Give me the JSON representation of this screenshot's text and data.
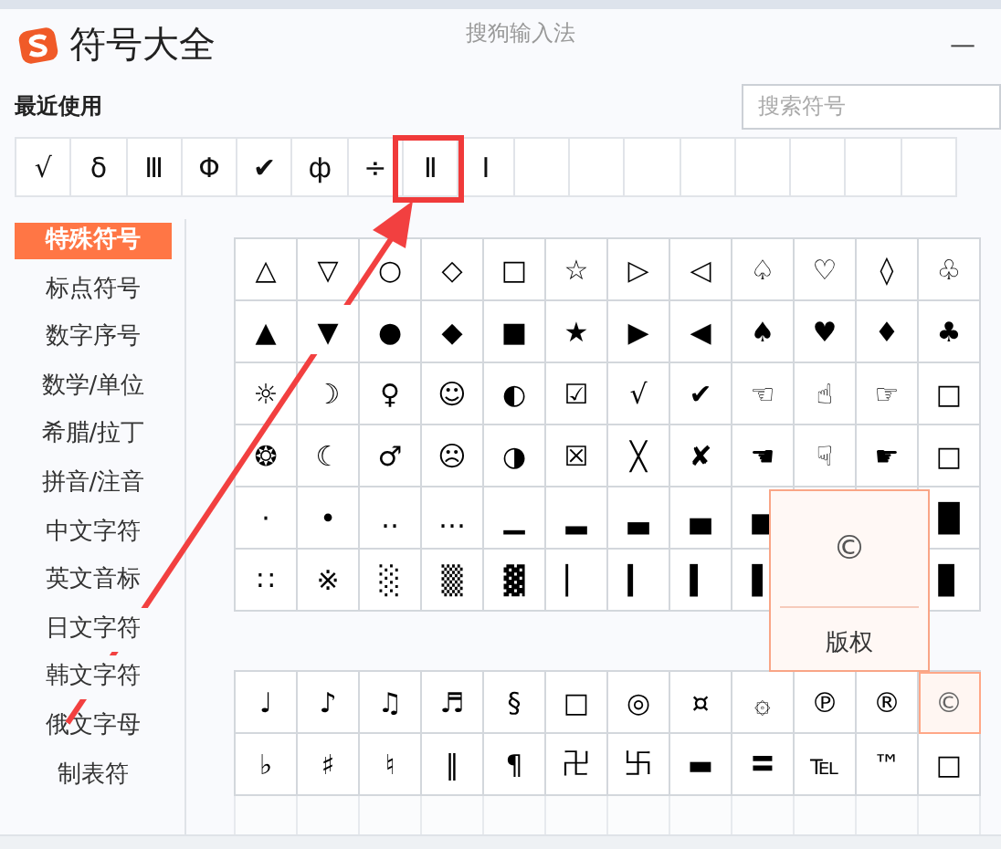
{
  "window": {
    "title": "符号大全",
    "app_name": "搜狗输入法",
    "minimize": "—"
  },
  "recent": {
    "label": "最近使用",
    "symbols": [
      "√",
      "δ",
      "Ⅲ",
      "Φ",
      "✔",
      "ф",
      "÷",
      "Ⅱ",
      "Ⅰ"
    ]
  },
  "search": {
    "placeholder": "搜索符号"
  },
  "sidebar": {
    "items": [
      {
        "label": "特殊符号",
        "selected": true
      },
      {
        "label": "标点符号",
        "selected": false
      },
      {
        "label": "数字序号",
        "selected": false
      },
      {
        "label": "数学/单位",
        "selected": false
      },
      {
        "label": "希腊/拉丁",
        "selected": false
      },
      {
        "label": "拼音/注音",
        "selected": false
      },
      {
        "label": "中文字符",
        "selected": false
      },
      {
        "label": "英文音标",
        "selected": false
      },
      {
        "label": "日文字符",
        "selected": false
      },
      {
        "label": "韩文字符",
        "selected": false
      },
      {
        "label": "俄文字母",
        "selected": false
      },
      {
        "label": "制表符",
        "selected": false
      }
    ]
  },
  "sections": [
    {
      "rows": [
        [
          {
            "symbol": "△",
            "hovered": false
          },
          {
            "symbol": "▽",
            "hovered": false
          },
          {
            "symbol": "○",
            "hovered": false
          },
          {
            "symbol": "◇",
            "hovered": false
          },
          {
            "symbol": "□",
            "hovered": false
          },
          {
            "symbol": "☆",
            "hovered": false
          },
          {
            "symbol": "▷",
            "hovered": false
          },
          {
            "symbol": "◁",
            "hovered": false
          },
          {
            "symbol": "♤",
            "hovered": false
          },
          {
            "symbol": "♡",
            "hovered": false
          },
          {
            "symbol": "◊",
            "hovered": false
          },
          {
            "symbol": "♧",
            "hovered": false
          }
        ],
        [
          {
            "symbol": "▲",
            "hovered": false
          },
          {
            "symbol": "▼",
            "hovered": false
          },
          {
            "symbol": "●",
            "hovered": false
          },
          {
            "symbol": "◆",
            "hovered": false
          },
          {
            "symbol": "■",
            "hovered": false
          },
          {
            "symbol": "★",
            "hovered": false
          },
          {
            "symbol": "▶",
            "hovered": false
          },
          {
            "symbol": "◀",
            "hovered": false
          },
          {
            "symbol": "♠",
            "hovered": false
          },
          {
            "symbol": "♥",
            "hovered": false
          },
          {
            "symbol": "♦",
            "hovered": false
          },
          {
            "symbol": "♣",
            "hovered": false
          }
        ],
        [
          {
            "symbol": "☼",
            "hovered": false
          },
          {
            "symbol": "☽",
            "hovered": false
          },
          {
            "symbol": "♀",
            "hovered": false
          },
          {
            "symbol": "☺",
            "hovered": false
          },
          {
            "symbol": "◐",
            "hovered": false
          },
          {
            "symbol": "☑",
            "hovered": false
          },
          {
            "symbol": "√",
            "hovered": false
          },
          {
            "symbol": "✔",
            "hovered": false
          },
          {
            "symbol": "☜",
            "hovered": false
          },
          {
            "symbol": "☝",
            "hovered": false
          },
          {
            "symbol": "☞",
            "hovered": false
          },
          {
            "symbol": "□",
            "hovered": false
          }
        ],
        [
          {
            "symbol": "❂",
            "hovered": false
          },
          {
            "symbol": "☾",
            "hovered": false
          },
          {
            "symbol": "♂",
            "hovered": false
          },
          {
            "symbol": "☹",
            "hovered": false
          },
          {
            "symbol": "◑",
            "hovered": false
          },
          {
            "symbol": "☒",
            "hovered": false
          },
          {
            "symbol": "╳",
            "hovered": false
          },
          {
            "symbol": "✘",
            "hovered": false
          },
          {
            "symbol": "☚",
            "hovered": false
          },
          {
            "symbol": "☟",
            "hovered": false
          },
          {
            "symbol": "☛",
            "hovered": false
          },
          {
            "symbol": "□",
            "hovered": false
          }
        ],
        [
          {
            "symbol": "·",
            "hovered": false
          },
          {
            "symbol": "•",
            "hovered": false
          },
          {
            "symbol": "‥",
            "hovered": false
          },
          {
            "symbol": "…",
            "hovered": false
          },
          {
            "symbol": "▁",
            "hovered": false
          },
          {
            "symbol": "▂",
            "hovered": false
          },
          {
            "symbol": "▃",
            "hovered": false
          },
          {
            "symbol": "▄",
            "hovered": false
          },
          {
            "symbol": "▅",
            "hovered": false
          },
          null,
          null,
          {
            "symbol": "█",
            "hovered": false
          }
        ],
        [
          {
            "symbol": "∷",
            "hovered": false
          },
          {
            "symbol": "※",
            "hovered": false
          },
          {
            "symbol": "░",
            "hovered": false
          },
          {
            "symbol": "▒",
            "hovered": false
          },
          {
            "symbol": "▓",
            "hovered": false
          },
          {
            "symbol": "▏",
            "hovered": false
          },
          {
            "symbol": "▎",
            "hovered": false
          },
          {
            "symbol": "▍",
            "hovered": false
          },
          {
            "symbol": "▌",
            "hovered": false
          },
          null,
          null,
          {
            "symbol": "▊",
            "hovered": false
          }
        ]
      ]
    },
    {
      "rows": [
        [
          {
            "symbol": "♩",
            "hovered": false
          },
          {
            "symbol": "♪",
            "hovered": false
          },
          {
            "symbol": "♫",
            "hovered": false
          },
          {
            "symbol": "♬",
            "hovered": false
          },
          {
            "symbol": "§",
            "hovered": false
          },
          {
            "symbol": "□",
            "hovered": false
          },
          {
            "symbol": "◎",
            "hovered": false
          },
          {
            "symbol": "¤",
            "hovered": false
          },
          {
            "symbol": "۞",
            "hovered": false
          },
          {
            "symbol": "℗",
            "hovered": false
          },
          {
            "symbol": "®",
            "hovered": false
          },
          {
            "symbol": "©",
            "hovered": true
          }
        ],
        [
          {
            "symbol": "♭",
            "hovered": false
          },
          {
            "symbol": "♯",
            "hovered": false
          },
          {
            "symbol": "♮",
            "hovered": false
          },
          {
            "symbol": "‖",
            "hovered": false
          },
          {
            "symbol": "¶",
            "hovered": false
          },
          {
            "symbol": "卍",
            "hovered": false
          },
          {
            "symbol": "卐",
            "hovered": false
          },
          {
            "symbol": "▬",
            "hovered": false
          },
          {
            "symbol": "〓",
            "hovered": false
          },
          {
            "symbol": "℡",
            "hovered": false
          },
          {
            "symbol": "™",
            "hovered": false
          },
          {
            "symbol": "□",
            "hovered": false
          }
        ]
      ]
    }
  ],
  "tooltip": {
    "symbol": "©",
    "name": "版权"
  }
}
